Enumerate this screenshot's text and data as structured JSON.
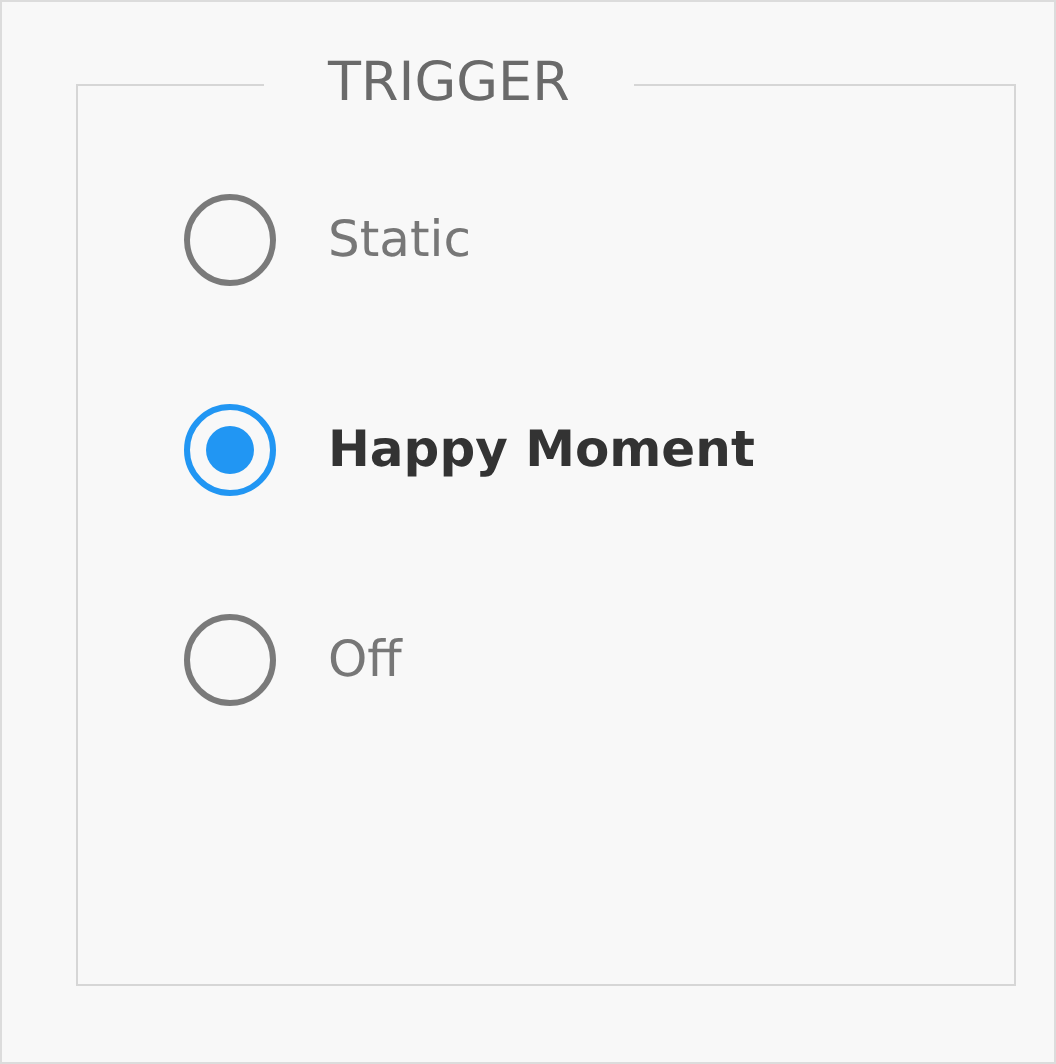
{
  "group": {
    "title": "TRIGGER"
  },
  "options": [
    {
      "label": "Static",
      "selected": false
    },
    {
      "label": "Happy Moment",
      "selected": true
    },
    {
      "label": "Off",
      "selected": false
    }
  ]
}
